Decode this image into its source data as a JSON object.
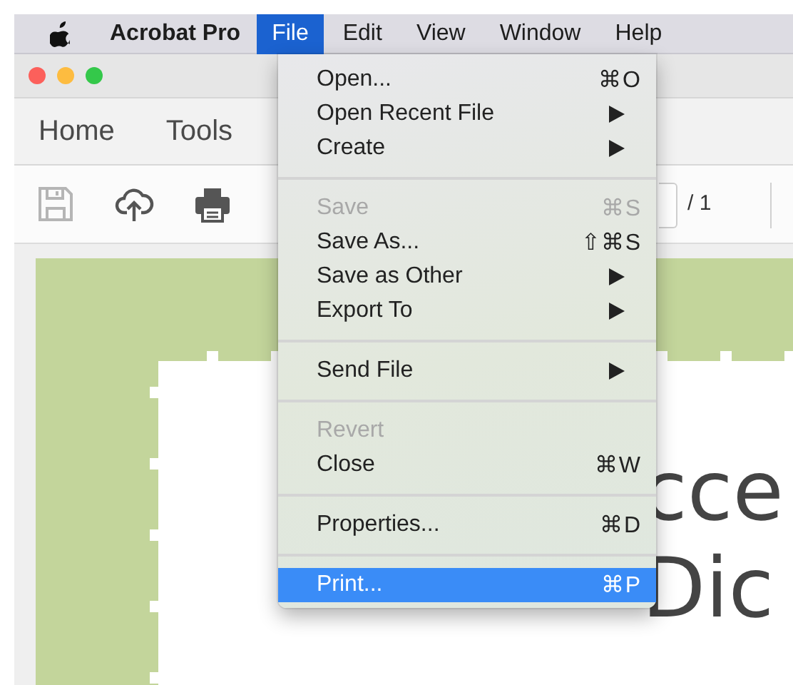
{
  "menubar": {
    "app": "Acrobat Pro",
    "menus": [
      {
        "label": "File",
        "selected": true
      },
      {
        "label": "Edit",
        "selected": false
      },
      {
        "label": "View",
        "selected": false
      },
      {
        "label": "Window",
        "selected": false
      },
      {
        "label": "Help",
        "selected": false
      }
    ]
  },
  "window": {
    "tabs": [
      {
        "label": "Home"
      },
      {
        "label": "Tools"
      }
    ],
    "toolbar": {
      "page_total": "/ 1"
    }
  },
  "document": {
    "lines": [
      "cce",
      "Dic"
    ]
  },
  "file_menu": {
    "items": [
      {
        "kind": "item",
        "label": "Open...",
        "shortcut": "⌘O",
        "disabled": false,
        "selected": false
      },
      {
        "kind": "submenu",
        "label": "Open Recent File",
        "disabled": false,
        "selected": false
      },
      {
        "kind": "submenu",
        "label": "Create",
        "disabled": false,
        "selected": false
      },
      {
        "kind": "separator"
      },
      {
        "kind": "item",
        "label": "Save",
        "shortcut": "⌘S",
        "disabled": true,
        "selected": false
      },
      {
        "kind": "item",
        "label": "Save As...",
        "shortcut": "⇧⌘S",
        "disabled": false,
        "selected": false
      },
      {
        "kind": "submenu",
        "label": "Save as Other",
        "disabled": false,
        "selected": false
      },
      {
        "kind": "submenu",
        "label": "Export To",
        "disabled": false,
        "selected": false
      },
      {
        "kind": "separator"
      },
      {
        "kind": "submenu",
        "label": "Send File",
        "disabled": false,
        "selected": false
      },
      {
        "kind": "separator"
      },
      {
        "kind": "item",
        "label": "Revert",
        "disabled": true,
        "selected": false
      },
      {
        "kind": "item",
        "label": "Close",
        "shortcut": "⌘W",
        "disabled": false,
        "selected": false
      },
      {
        "kind": "separator"
      },
      {
        "kind": "item",
        "label": "Properties...",
        "shortcut": "⌘D",
        "disabled": false,
        "selected": false
      },
      {
        "kind": "separator"
      },
      {
        "kind": "item",
        "label": "Print...",
        "shortcut": "⌘P",
        "disabled": false,
        "selected": true
      }
    ]
  }
}
